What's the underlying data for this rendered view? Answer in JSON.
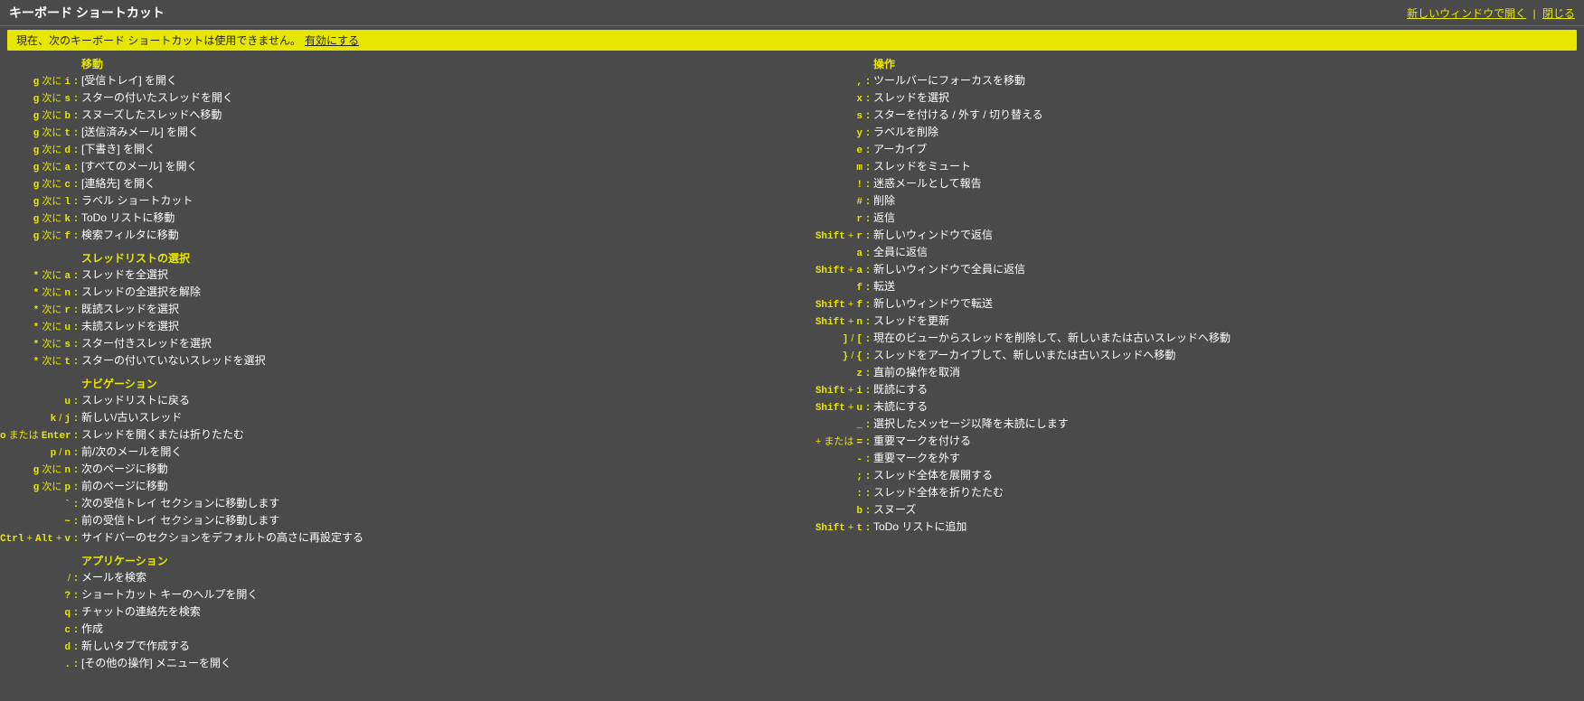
{
  "header": {
    "title": "キーボード ショートカット",
    "open_new_window": "新しいウィンドウで開く",
    "close": "閉じる"
  },
  "warning": {
    "text": "現在、次のキーボード ショートカットは使用できません。",
    "enable": "有効にする"
  },
  "sections_left": [
    {
      "title": "移動",
      "rows": [
        {
          "k": [
            "g",
            "次に",
            "i"
          ],
          "d": "[受信トレイ] を開く"
        },
        {
          "k": [
            "g",
            "次に",
            "s"
          ],
          "d": "スターの付いたスレッドを開く"
        },
        {
          "k": [
            "g",
            "次に",
            "b"
          ],
          "d": "スヌーズしたスレッドへ移動"
        },
        {
          "k": [
            "g",
            "次に",
            "t"
          ],
          "d": "[送信済みメール] を開く"
        },
        {
          "k": [
            "g",
            "次に",
            "d"
          ],
          "d": "[下書き] を開く"
        },
        {
          "k": [
            "g",
            "次に",
            "a"
          ],
          "d": "[すべてのメール] を開く"
        },
        {
          "k": [
            "g",
            "次に",
            "c"
          ],
          "d": "[連絡先] を開く"
        },
        {
          "k": [
            "g",
            "次に",
            "l"
          ],
          "d": "ラベル ショートカット"
        },
        {
          "k": [
            "g",
            "次に",
            "k"
          ],
          "d": "ToDo リストに移動"
        },
        {
          "k": [
            "g",
            "次に",
            "f"
          ],
          "d": "検索フィルタに移動"
        }
      ]
    },
    {
      "title": "スレッドリストの選択",
      "rows": [
        {
          "k": [
            "*",
            "次に",
            "a"
          ],
          "d": "スレッドを全選択"
        },
        {
          "k": [
            "*",
            "次に",
            "n"
          ],
          "d": "スレッドの全選択を解除"
        },
        {
          "k": [
            "*",
            "次に",
            "r"
          ],
          "d": "既読スレッドを選択"
        },
        {
          "k": [
            "*",
            "次に",
            "u"
          ],
          "d": "未読スレッドを選択"
        },
        {
          "k": [
            "*",
            "次に",
            "s"
          ],
          "d": "スター付きスレッドを選択"
        },
        {
          "k": [
            "*",
            "次に",
            "t"
          ],
          "d": "スターの付いていないスレッドを選択"
        }
      ]
    },
    {
      "title": "ナビゲーション",
      "rows": [
        {
          "k": [
            "u"
          ],
          "d": "スレッドリストに戻る"
        },
        {
          "k": [
            "k",
            "/",
            "j"
          ],
          "d": "新しい/古いスレッド"
        },
        {
          "k": [
            "o",
            "または",
            "Enter"
          ],
          "d": "スレッドを開くまたは折りたたむ"
        },
        {
          "k": [
            "p",
            "/",
            "n"
          ],
          "d": "前/次のメールを開く"
        },
        {
          "k": [
            "g",
            "次に",
            "n"
          ],
          "d": "次のページに移動"
        },
        {
          "k": [
            "g",
            "次に",
            "p"
          ],
          "d": "前のページに移動"
        },
        {
          "k": [
            "`"
          ],
          "d": "次の受信トレイ セクションに移動します"
        },
        {
          "k": [
            "~"
          ],
          "d": "前の受信トレイ セクションに移動します"
        },
        {
          "k": [
            "Ctrl",
            "+",
            "Alt",
            "+",
            "v"
          ],
          "d": "サイドバーのセクションをデフォルトの高さに再設定する"
        }
      ]
    },
    {
      "title": "アプリケーション",
      "rows": [
        {
          "k": [
            "/"
          ],
          "d": "メールを検索"
        },
        {
          "k": [
            "?"
          ],
          "d": "ショートカット キーのヘルプを開く"
        },
        {
          "k": [
            "q"
          ],
          "d": "チャットの連絡先を検索"
        },
        {
          "k": [
            "c"
          ],
          "d": "作成"
        },
        {
          "k": [
            "d"
          ],
          "d": "新しいタブで作成する"
        },
        {
          "k": [
            "."
          ],
          "d": "[その他の操作] メニューを開く"
        }
      ]
    }
  ],
  "sections_right": [
    {
      "title": "操作",
      "rows": [
        {
          "k": [
            ","
          ],
          "d": "ツールバーにフォーカスを移動"
        },
        {
          "k": [
            "x"
          ],
          "d": "スレッドを選択"
        },
        {
          "k": [
            "s"
          ],
          "d": "スターを付ける / 外す / 切り替える"
        },
        {
          "k": [
            "y"
          ],
          "d": "ラベルを削除"
        },
        {
          "k": [
            "e"
          ],
          "d": "アーカイブ"
        },
        {
          "k": [
            "m"
          ],
          "d": "スレッドをミュート"
        },
        {
          "k": [
            "!"
          ],
          "d": "迷惑メールとして報告"
        },
        {
          "k": [
            "#"
          ],
          "d": "削除"
        },
        {
          "k": [
            "r"
          ],
          "d": "返信"
        },
        {
          "k": [
            "Shift",
            "+",
            "r"
          ],
          "d": "新しいウィンドウで返信"
        },
        {
          "k": [
            "a"
          ],
          "d": "全員に返信"
        },
        {
          "k": [
            "Shift",
            "+",
            "a"
          ],
          "d": "新しいウィンドウで全員に返信"
        },
        {
          "k": [
            "f"
          ],
          "d": "転送"
        },
        {
          "k": [
            "Shift",
            "+",
            "f"
          ],
          "d": "新しいウィンドウで転送"
        },
        {
          "k": [
            "Shift",
            "+",
            "n"
          ],
          "d": "スレッドを更新"
        },
        {
          "k": [
            "]",
            "/",
            "["
          ],
          "d": "現在のビューからスレッドを削除して、新しいまたは古いスレッドへ移動"
        },
        {
          "k": [
            "}",
            "/",
            "{"
          ],
          "d": "スレッドをアーカイブして、新しいまたは古いスレッドへ移動"
        },
        {
          "k": [
            "z"
          ],
          "d": "直前の操作を取消"
        },
        {
          "k": [
            "Shift",
            "+",
            "i"
          ],
          "d": "既読にする"
        },
        {
          "k": [
            "Shift",
            "+",
            "u"
          ],
          "d": "未読にする"
        },
        {
          "k": [
            "_"
          ],
          "d": "選択したメッセージ以降を未読にします"
        },
        {
          "k": [
            "+",
            "または",
            "="
          ],
          "d": "重要マークを付ける"
        },
        {
          "k": [
            "-"
          ],
          "d": "重要マークを外す"
        },
        {
          "k": [
            ";"
          ],
          "d": "スレッド全体を展開する"
        },
        {
          "k": [
            ":"
          ],
          "d": "スレッド全体を折りたたむ"
        },
        {
          "k": [
            "b"
          ],
          "d": "スヌーズ"
        },
        {
          "k": [
            "Shift",
            "+",
            "t"
          ],
          "d": "ToDo リストに追加"
        }
      ]
    }
  ]
}
